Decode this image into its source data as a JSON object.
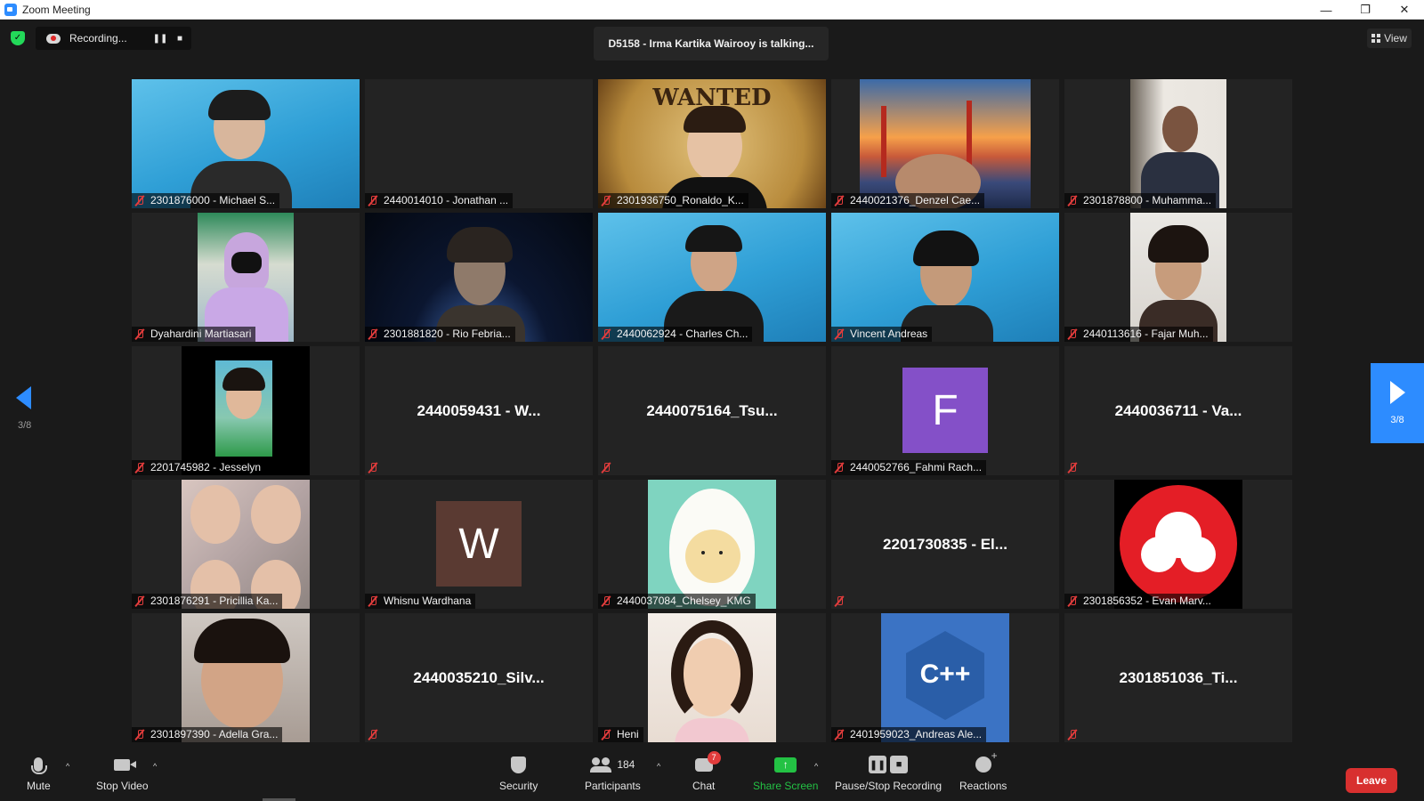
{
  "window": {
    "title": "Zoom Meeting",
    "controls": [
      "—",
      "❐",
      "✕"
    ]
  },
  "top_bar": {
    "recording_text": "Recording...",
    "pause_symbol": "❚❚",
    "stop_symbol": "■",
    "talking_banner": "D5158 - Irma Kartika Wairooy is talking...",
    "view_label": "View"
  },
  "pagination": {
    "left_page": "3/8",
    "right_page": "3/8"
  },
  "colors": {
    "accent": "#2d8cff",
    "mute_red": "#e23c3c",
    "share_green": "#23c244",
    "leave_red": "#d8302f",
    "tile_bg": "#232323",
    "avatar_f": "#8450c8",
    "avatar_w": "#5a3a32"
  },
  "tiles": [
    {
      "name": "2301876000 - Michael S..."
    },
    {
      "name": "2440014010 - Jonathan ..."
    },
    {
      "name": "2301936750_Ronaldo_K..."
    },
    {
      "name": "2440021376_Denzel Cae..."
    },
    {
      "name": "2301878800 - Muhamma..."
    },
    {
      "name": "Dyahardini Martiasari"
    },
    {
      "name": "2301881820 - Rio Febria..."
    },
    {
      "name": "2440062924 - Charles Ch..."
    },
    {
      "name": "Vincent Andreas"
    },
    {
      "name": "2440113616 - Fajar Muh..."
    },
    {
      "name": "2201745982 - Jesselyn"
    },
    {
      "name": "",
      "center_name": "2440059431 - W..."
    },
    {
      "name": "",
      "center_name": "2440075164_Tsu..."
    },
    {
      "name": "2440052766_Fahmi Rach...",
      "avatar_letter": "F"
    },
    {
      "name": "",
      "center_name": "2440036711 - Va..."
    },
    {
      "name": "2301876291 - Pricillia Ka..."
    },
    {
      "name": "Whisnu Wardhana",
      "avatar_letter": "W"
    },
    {
      "name": "2440037084_Chelsey_KMG"
    },
    {
      "name": "",
      "center_name": "2201730835 - El..."
    },
    {
      "name": "2301856352 - Evan Marv..."
    },
    {
      "name": "2301897390 - Adella Gra..."
    },
    {
      "name": "",
      "center_name": "2440035210_Silv..."
    },
    {
      "name": "Heni"
    },
    {
      "name": "2401959023_Andreas Ale..."
    },
    {
      "name": "",
      "center_name": "2301851036_Ti..."
    }
  ],
  "video_texts": {
    "wanted": "WANTED",
    "cpp": "C++"
  },
  "toolbar": {
    "mute": "Mute",
    "stop_video": "Stop Video",
    "security": "Security",
    "participants": "Participants",
    "participants_count": "184",
    "chat": "Chat",
    "chat_badge": "7",
    "share_screen": "Share Screen",
    "pause_stop_recording": "Pause/Stop Recording",
    "reactions": "Reactions",
    "leave": "Leave",
    "caret": "^"
  }
}
